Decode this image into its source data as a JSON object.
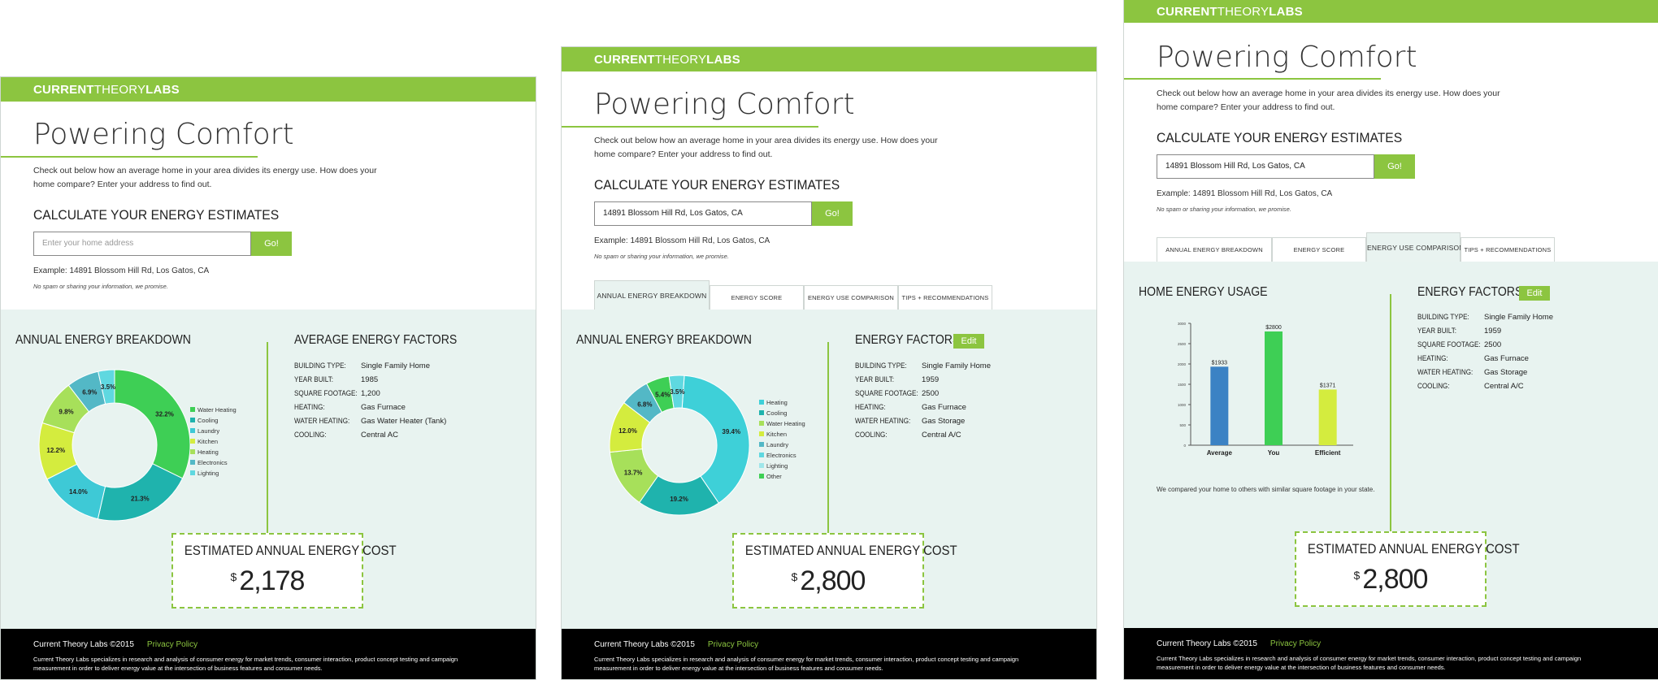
{
  "brand": {
    "bold": "CURRENT",
    "thin": "THEORY",
    "bold2": "LABS"
  },
  "page": {
    "title": "Powering Comfort",
    "intro": "Check out below how an average home in your area divides its energy use. How does your home compare? Enter your address to find out.",
    "calc_heading": "CALCULATE YOUR ENERGY ESTIMATES",
    "go_label": "Go!",
    "example": "Example: 14891 Blossom Hill Rd, Los Gatos, CA",
    "nospam": "No spam or sharing your information, we promise."
  },
  "colors": {
    "accent": "#8cc540",
    "lower_bg": "#e8f3f0"
  },
  "footer": {
    "copyright": "Current Theory Labs ©2015",
    "privacy": "Privacy Policy",
    "about": "Current Theory Labs specializes in research and analysis of consumer energy for market trends, consumer interaction, product concept testing and campaign measurement in order to deliver energy value at the intersection of business features and consumer needs."
  },
  "tabs": [
    "ANNUAL ENERGY BREAKDOWN",
    "ENERGY SCORE",
    "ENERGY USE COMPARISON",
    "TIPS + RECOMMENDATIONS"
  ],
  "fact_keys": [
    "BUILDING TYPE:",
    "YEAR BUILT:",
    "SQUARE FOOTAGE:",
    "HEATING:",
    "WATER HEATING:",
    "COOLING:"
  ],
  "cost_label": "ESTIMATED ANNUAL ENERGY COST",
  "currency": "$",
  "panel1": {
    "address_placeholder": "Enter your home address",
    "breakdown_heading": "ANNUAL ENERGY BREAKDOWN",
    "factors_heading": "AVERAGE ENERGY FACTORS",
    "facts": [
      "Single Family Home",
      "1985",
      "1,200",
      "Gas Furnace",
      "Gas Water Heater (Tank)",
      "Central AC"
    ],
    "cost": "2,178"
  },
  "panel2": {
    "address_value": "14891 Blossom Hill Rd, Los Gatos, CA",
    "active_tab": 0,
    "breakdown_heading": "ANNUAL ENERGY BREAKDOWN",
    "factors_heading": "ENERGY FACTORS",
    "edit_label": "Edit",
    "facts": [
      "Single Family Home",
      "1959",
      "2500",
      "Gas Furnace",
      "Gas Storage",
      "Central A/C"
    ],
    "cost": "2,800"
  },
  "panel3": {
    "address_value": "14891 Blossom Hill Rd, Los Gatos, CA",
    "active_tab": 2,
    "usage_heading": "HOME ENERGY USAGE",
    "factors_heading": "ENERGY FACTORS",
    "edit_label": "Edit",
    "facts": [
      "Single Family Home",
      "1959",
      "2500",
      "Gas Furnace",
      "Gas Storage",
      "Central A/C"
    ],
    "comparison_note": "We compared your home to others with similar square footage in your state.",
    "cost": "2,800"
  },
  "chart_data": [
    {
      "type": "pie",
      "variant": "donut",
      "series": [
        {
          "name": "Water Heating",
          "value": 32.2,
          "label": "32.2%",
          "color": "#3ecf55"
        },
        {
          "name": "Cooling",
          "value": 21.3,
          "label": "21.3%",
          "color": "#1fb3ad"
        },
        {
          "name": "Laundry",
          "value": 14.0,
          "label": "14.0%",
          "color": "#3ec9d6"
        },
        {
          "name": "Kitchen",
          "value": 12.2,
          "label": "12.2%",
          "color": "#d4ec3e"
        },
        {
          "name": "Heating",
          "value": 9.8,
          "label": "9.8%",
          "color": "#a7e05a"
        },
        {
          "name": "Electronics",
          "value": 6.9,
          "label": "6.9%",
          "color": "#53b8c6"
        },
        {
          "name": "Lighting",
          "value": 3.5,
          "label": "3.5%",
          "color": "#5fd8e0"
        }
      ]
    },
    {
      "type": "pie",
      "variant": "donut",
      "series": [
        {
          "name": "Heating",
          "value": 39.4,
          "label": "39.4%",
          "color": "#3ed0d8"
        },
        {
          "name": "Cooling",
          "value": 19.2,
          "label": "19.2%",
          "color": "#1fb3ad"
        },
        {
          "name": "Water Heating",
          "value": 13.7,
          "label": "13.7%",
          "color": "#a7e05a"
        },
        {
          "name": "Kitchen",
          "value": 12.0,
          "label": "12.0%",
          "color": "#d4ec3e"
        },
        {
          "name": "Laundry",
          "value": 6.8,
          "label": "6.8%",
          "color": "#53b8c6"
        },
        {
          "name": "Other",
          "value": 5.4,
          "label": "5.4%",
          "color": "#3ecf55"
        },
        {
          "name": "Electronics",
          "value": 3.5,
          "label": "3.5%",
          "color": "#5fd8e0"
        }
      ],
      "legend": [
        {
          "name": "Heating",
          "color": "#3ed0d8"
        },
        {
          "name": "Cooling",
          "color": "#1fb3ad"
        },
        {
          "name": "Water Heating",
          "color": "#a7e05a"
        },
        {
          "name": "Kitchen",
          "color": "#d4ec3e"
        },
        {
          "name": "Laundry",
          "color": "#53b8c6"
        },
        {
          "name": "Electronics",
          "color": "#5fd8e0"
        },
        {
          "name": "Lighting",
          "color": "#9fe6ea"
        },
        {
          "name": "Other",
          "color": "#3ecf55"
        }
      ]
    },
    {
      "type": "bar",
      "categories": [
        "Average",
        "You",
        "Efficient"
      ],
      "values": [
        1933,
        2800,
        1371
      ],
      "labels": [
        "$1933",
        "$2800",
        "$1371"
      ],
      "colors": [
        "#3b82c4",
        "#3ecf55",
        "#d4ec3e"
      ],
      "ylim": [
        0,
        3000
      ],
      "yticks": [
        0,
        500,
        1000,
        1500,
        2000,
        2500,
        3000
      ]
    }
  ]
}
